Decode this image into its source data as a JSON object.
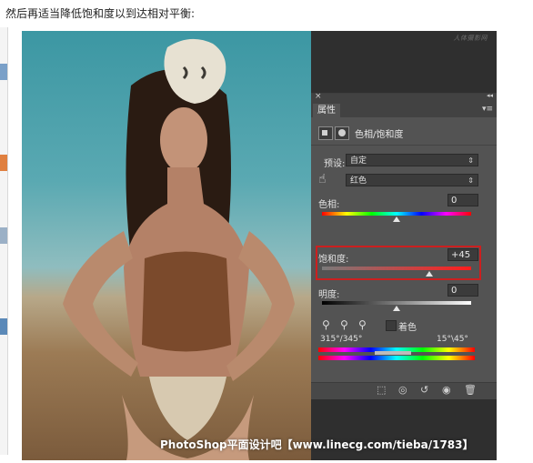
{
  "caption": "然后再适当降低饱和度以到达相对平衡:",
  "brand": "人体摄影网",
  "panel": {
    "tab": "属性",
    "title": "色相/饱和度",
    "preset_label": "预设:",
    "preset_value": "自定",
    "channel_value": "红色",
    "hue_label": "色相:",
    "hue_value": "0",
    "hue_level": 0.5,
    "saturation_label": "饱和度:",
    "saturation_value": "+45",
    "saturation_level": 0.72,
    "lightness_label": "明度:",
    "lightness_value": "0",
    "lightness_level": 0.5,
    "colorize_label": "着色",
    "range_left": "315°/345°",
    "range_right": "15°\\45°"
  },
  "watermark": "PhotoShop平面设计吧【www.linecg.com/tieba/1783】",
  "colors": {
    "panel_bg": "#535353",
    "highlight": "#cc1f1f",
    "hue_gradient": [
      "#ff0000",
      "#ffff00",
      "#00ff00",
      "#00ffff",
      "#0000ff",
      "#ff00ff",
      "#ff0000"
    ]
  }
}
